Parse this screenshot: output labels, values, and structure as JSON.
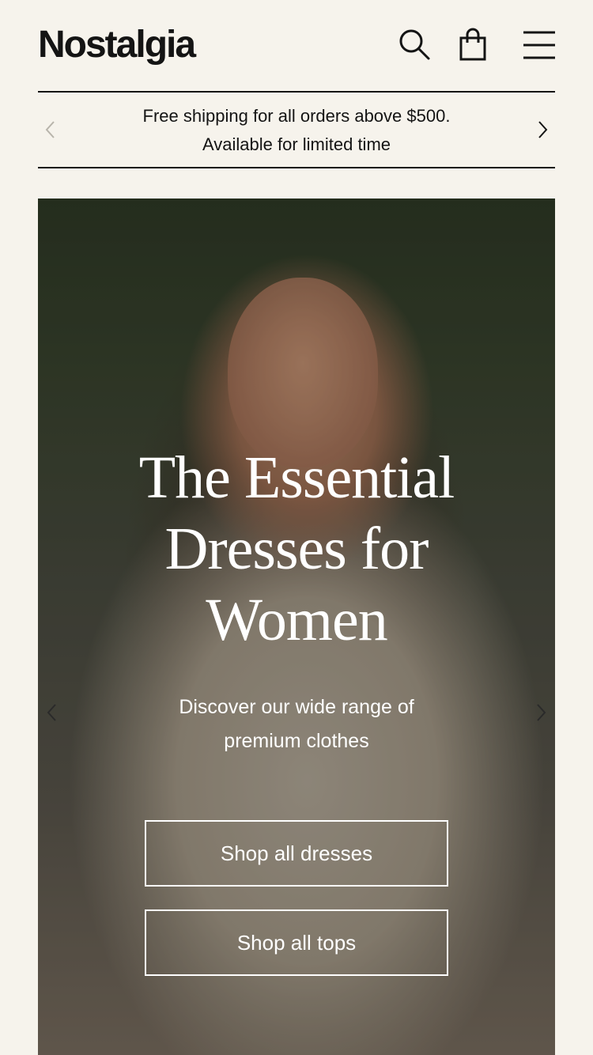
{
  "header": {
    "logo": "Nostalgia",
    "icons": {
      "search": "search-icon",
      "bag": "shopping-bag-icon",
      "menu": "menu-icon"
    }
  },
  "announcement": {
    "line1": "Free shipping for all orders above $500.",
    "line2": "Available for limited time",
    "prev_icon": "chevron-left-icon",
    "next_icon": "chevron-right-icon"
  },
  "hero": {
    "title_line1": "The Essential",
    "title_line2": "Dresses for",
    "title_line3": "Women",
    "subtitle_line1": "Discover our wide range of",
    "subtitle_line2": "premium clothes",
    "primary_button": "Shop all dresses",
    "secondary_button": "Shop all tops",
    "prev_icon": "chevron-left-icon",
    "next_icon": "chevron-right-icon"
  },
  "colors": {
    "background": "#f6f3ec",
    "text": "#141414",
    "hero_text": "#ffffff"
  }
}
